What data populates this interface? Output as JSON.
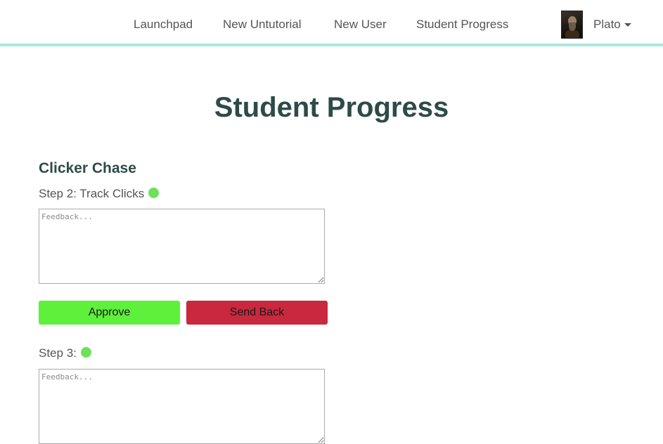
{
  "nav": {
    "links": [
      "Launchpad",
      "New Untutorial",
      "New User",
      "Student Progress"
    ],
    "user_name": "Plato"
  },
  "page": {
    "title": "Student Progress"
  },
  "tutorial": {
    "title": "Clicker Chase",
    "steps": [
      {
        "label": "Step 2: Track Clicks",
        "status_color": "#6fe05a",
        "feedback_placeholder": "Feedback...",
        "feedback_value": ""
      },
      {
        "label": "Step 3:",
        "status_color": "#6fe05a",
        "feedback_placeholder": "Feedback...",
        "feedback_value": ""
      }
    ],
    "actions": {
      "approve_label": "Approve",
      "send_back_label": "Send Back"
    }
  },
  "colors": {
    "accent_border": "#a8e6de",
    "heading": "#2d4b48",
    "approve": "#5ef03a",
    "send_back": "#c9283e"
  },
  "icons": {
    "avatar": "user-portrait-avatar",
    "user_menu_caret": "chevron-down-icon",
    "status": "status-dot-icon"
  }
}
